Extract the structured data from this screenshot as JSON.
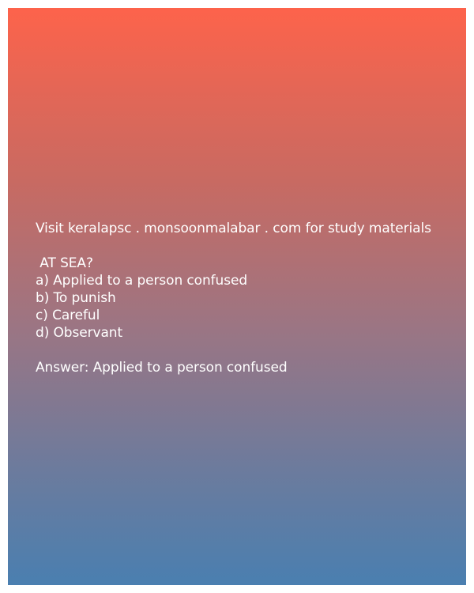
{
  "colors": {
    "gradient_top": "#fd634b",
    "gradient_bottom": "#4a7fb0",
    "text": "#ffffff"
  },
  "content": {
    "promo": "Visit keralapsc . monsoonmalabar . com for study materials",
    "question": " AT SEA?",
    "options": [
      "a) Applied to a person confused",
      "b) To punish",
      "c) Careful",
      "d) Observant"
    ],
    "answer": "Answer: Applied to a person confused"
  }
}
